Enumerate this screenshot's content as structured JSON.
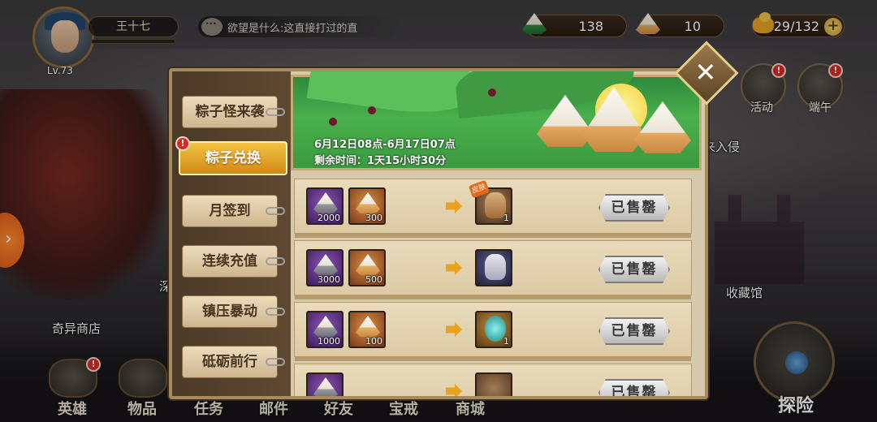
{
  "player": {
    "name": "王十七",
    "level": "Lv.73"
  },
  "chat": {
    "message": "欲望是什么:这直接打过的直"
  },
  "resources": {
    "green_zongzi": {
      "value": "138",
      "icon": "green-zongzi-icon"
    },
    "yellow_zongzi": {
      "value": "10",
      "icon": "yellow-zongzi-icon"
    },
    "stamina": {
      "value": "29/132",
      "icon": "stamina-icon",
      "plus": "+"
    }
  },
  "side_icons": [
    {
      "label": "活动",
      "badge": "!"
    },
    {
      "label": "端午",
      "badge": "!"
    }
  ],
  "background_labels": {
    "invasion": "来入侵",
    "museum": "收藏馆",
    "strange_shop": "奇异商店",
    "partial": "深"
  },
  "bottom_nav": [
    {
      "label": "英雄",
      "badge": "!"
    },
    {
      "label": "物品"
    },
    {
      "label": "任务"
    },
    {
      "label": "邮件"
    },
    {
      "label": "好友"
    },
    {
      "label": "宝戒"
    },
    {
      "label": "商城"
    }
  ],
  "explore": {
    "label": "探险"
  },
  "modal": {
    "close_icon": "close-icon",
    "tabs": [
      {
        "label": "粽子怪来袭",
        "active": false
      },
      {
        "label": "粽子兑换",
        "active": true,
        "badge": "!"
      },
      {
        "label": "月签到",
        "active": false
      },
      {
        "label": "连续充值",
        "active": false
      },
      {
        "label": "镇压暴动",
        "active": false
      },
      {
        "label": "砥砺前行",
        "active": false
      }
    ],
    "banner": {
      "period": "6月12日08点-6月17日07点",
      "remaining": "剩余时间：1天15小时30分"
    },
    "rows": [
      {
        "cost": [
          {
            "type": "purple",
            "count": "2000"
          },
          {
            "type": "orange",
            "count": "300"
          }
        ],
        "reward": {
          "kind": "hero-skin",
          "tag": "皮肤",
          "count": "1"
        },
        "button": "已售罄"
      },
      {
        "cost": [
          {
            "type": "purple",
            "count": "3000"
          },
          {
            "type": "orange",
            "count": "500"
          }
        ],
        "reward": {
          "kind": "hero-portrait",
          "count": ""
        },
        "button": "已售罄"
      },
      {
        "cost": [
          {
            "type": "purple",
            "count": "1000"
          },
          {
            "type": "orange",
            "count": "100"
          }
        ],
        "reward": {
          "kind": "spirit-orb",
          "count": "1"
        },
        "button": "已售罄"
      },
      {
        "cost": [
          {
            "type": "purple",
            "count": ""
          }
        ],
        "reward": {
          "kind": "item",
          "count": ""
        },
        "button": "已售罄"
      }
    ]
  }
}
